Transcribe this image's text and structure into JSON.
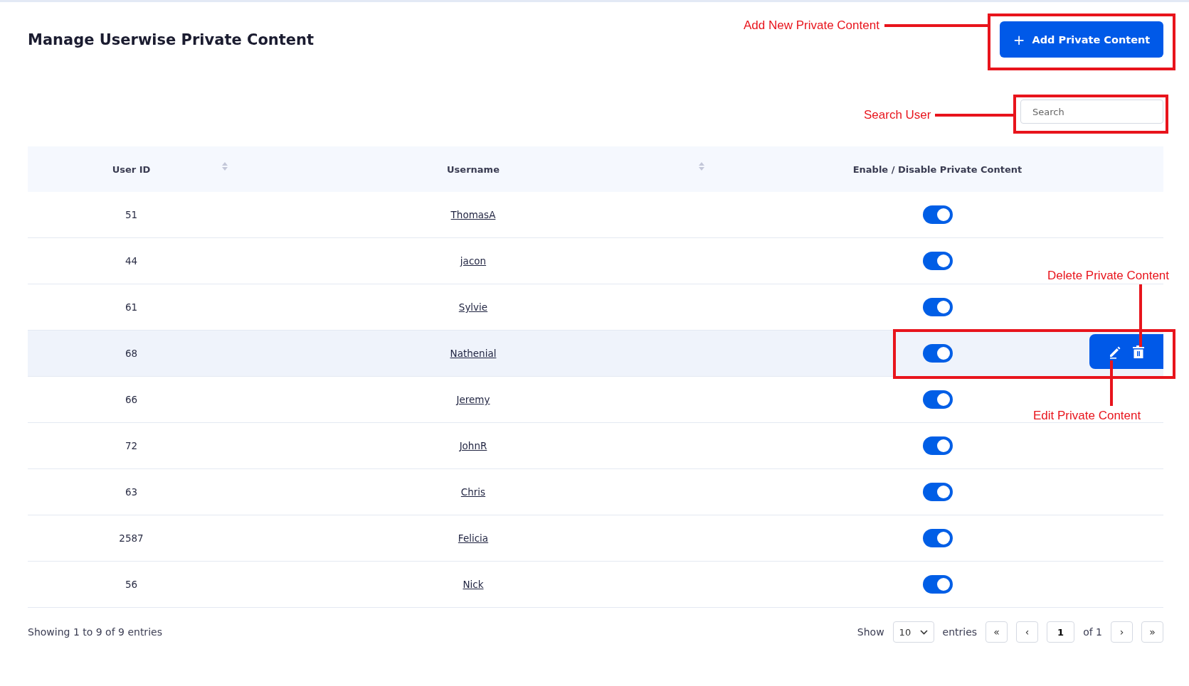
{
  "title": "Manage Userwise Private Content",
  "add_button": {
    "icon": "+",
    "label": "Add Private Content"
  },
  "search": {
    "placeholder": "Search"
  },
  "table": {
    "columns": [
      {
        "label": "User ID",
        "sortable": true
      },
      {
        "label": "Username",
        "sortable": true
      },
      {
        "label": "Enable / Disable Private Content",
        "sortable": false
      }
    ],
    "rows": [
      {
        "user_id": "51",
        "username": "ThomasA",
        "enabled": true,
        "selected": false
      },
      {
        "user_id": "44",
        "username": "jacon",
        "enabled": true,
        "selected": false
      },
      {
        "user_id": "61",
        "username": "Sylvie",
        "enabled": true,
        "selected": false
      },
      {
        "user_id": "68",
        "username": "Nathenial",
        "enabled": true,
        "selected": true
      },
      {
        "user_id": "66",
        "username": "Jeremy",
        "enabled": true,
        "selected": false
      },
      {
        "user_id": "72",
        "username": "JohnR",
        "enabled": true,
        "selected": false
      },
      {
        "user_id": "63",
        "username": "Chris",
        "enabled": true,
        "selected": false
      },
      {
        "user_id": "2587",
        "username": "Felicia",
        "enabled": true,
        "selected": false
      },
      {
        "user_id": "56",
        "username": "Nick",
        "enabled": true,
        "selected": false
      }
    ]
  },
  "footer": {
    "summary": "Showing 1 to 9 of 9 entries",
    "show_label": "Show",
    "page_size": "10",
    "entries_label": "entries",
    "first": "«",
    "prev": "‹",
    "page": "1",
    "page_of": "of 1",
    "next": "›",
    "last": "»"
  },
  "annotations": {
    "add": "Add New Private Content",
    "search": "Search User",
    "delete": "Delete Private Content",
    "edit": "Edit Private Content"
  }
}
